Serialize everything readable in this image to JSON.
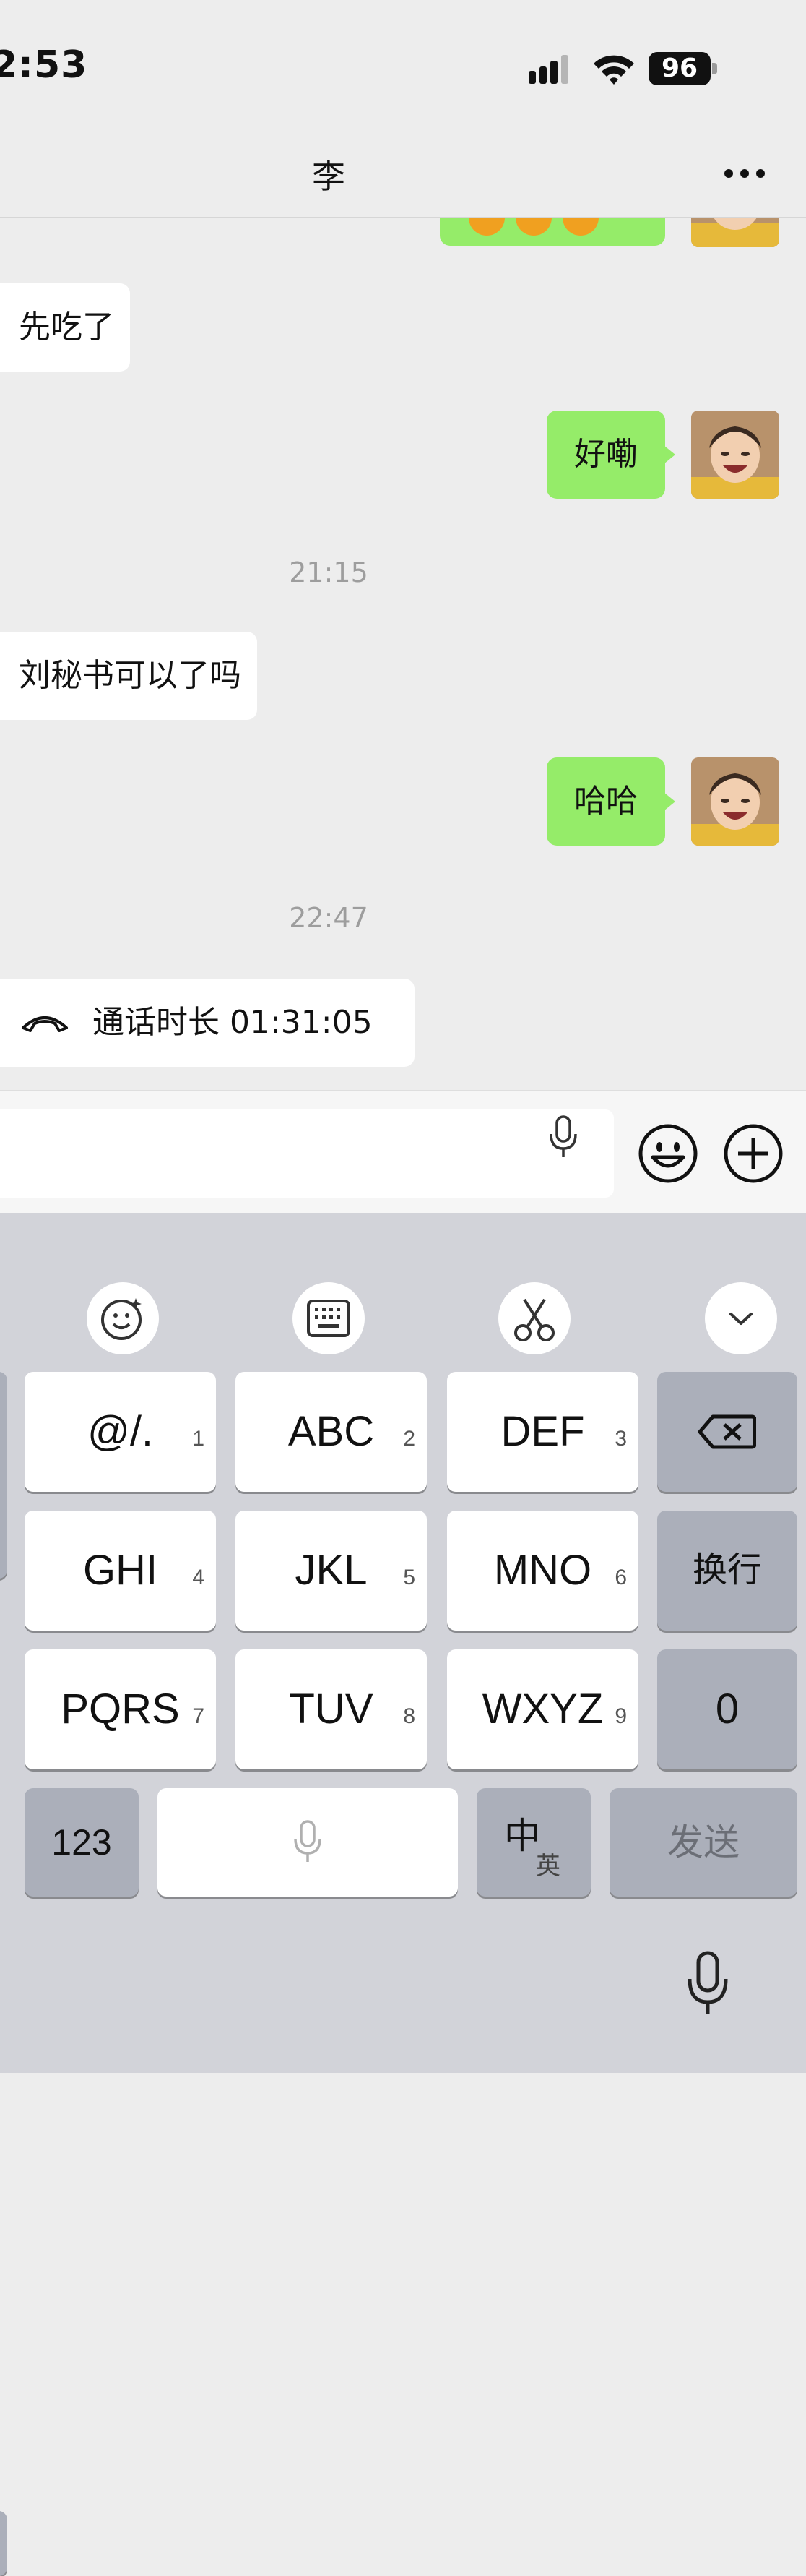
{
  "status_bar": {
    "time": "2:53",
    "battery": "96"
  },
  "nav": {
    "title": "李",
    "more_icon": "more-dots-icon"
  },
  "messages": {
    "m1": "先吃了",
    "m2": "好嘞",
    "ts1": "21:15",
    "m3": "刘秘书可以了吗",
    "m4": "哈哈",
    "ts2": "22:47",
    "call": "通话时长 01:31:05"
  },
  "input": {
    "value": "",
    "icons": [
      "voice-icon",
      "emoji-icon",
      "plus-icon"
    ]
  },
  "keyboard": {
    "toolbar": [
      "emoji-face-icon",
      "keyboard-icon",
      "scissors-icon",
      "collapse-chevron-icon"
    ],
    "rows": [
      {
        "k1": "@/.",
        "n1": "1",
        "k2": "ABC",
        "n2": "2",
        "k3": "DEF",
        "n3": "3"
      },
      {
        "k1": "GHI",
        "n1": "4",
        "k2": "JKL",
        "n2": "5",
        "k3": "MNO",
        "n3": "6",
        "side": "换行"
      },
      {
        "k1": "PQRS",
        "n1": "7",
        "k2": "TUV",
        "n2": "8",
        "k3": "WXYZ",
        "n3": "9",
        "side": "0"
      }
    ],
    "bottom": {
      "num": "123",
      "lang_main": "中",
      "lang_sub": "英",
      "send": "发送"
    }
  },
  "colors": {
    "sent_bubble": "#95ec69",
    "received_bubble": "#ffffff",
    "chat_bg": "#ededed",
    "keyboard_bg": "#d2d3d9"
  }
}
